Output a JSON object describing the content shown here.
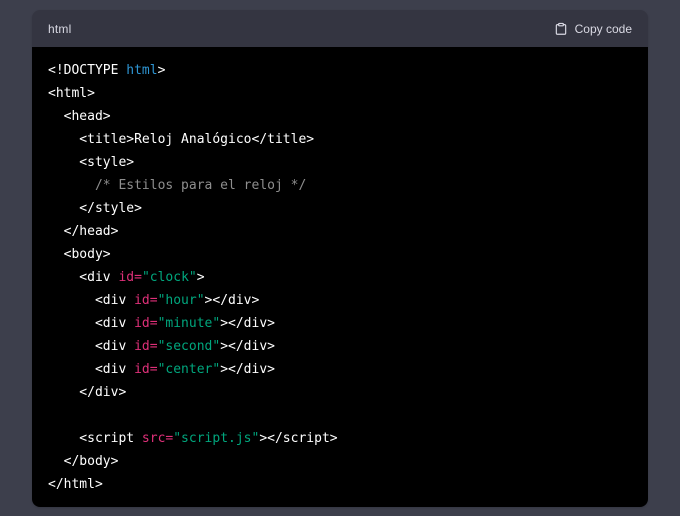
{
  "code_block": {
    "language_label": "html",
    "copy_button": {
      "label": "Copy code",
      "icon": "clipboard-icon"
    },
    "colors": {
      "page_bg": "#3d3f4c",
      "header_bg": "#343541",
      "code_bg": "#000000",
      "header_text": "#d9d9e3",
      "tag": "#ffffff",
      "keyword": "#2e95d3",
      "attribute": "#df3079",
      "string": "#00a67d",
      "comment": "#8e8e8e"
    },
    "lines": [
      [
        {
          "t": "tag",
          "s": "<!DOCTYPE "
        },
        {
          "t": "kw",
          "s": "html"
        },
        {
          "t": "tag",
          "s": ">"
        }
      ],
      [
        {
          "t": "tag",
          "s": "<html>"
        }
      ],
      [
        {
          "t": "tag",
          "s": "  <head>"
        }
      ],
      [
        {
          "t": "tag",
          "s": "    <title>"
        },
        {
          "t": "txt",
          "s": "Reloj Analógico"
        },
        {
          "t": "tag",
          "s": "</title>"
        }
      ],
      [
        {
          "t": "tag",
          "s": "    <style>"
        }
      ],
      [
        {
          "t": "cmt",
          "s": "      /* Estilos para el reloj */"
        }
      ],
      [
        {
          "t": "tag",
          "s": "    </style>"
        }
      ],
      [
        {
          "t": "tag",
          "s": "  </head>"
        }
      ],
      [
        {
          "t": "tag",
          "s": "  <body>"
        }
      ],
      [
        {
          "t": "tag",
          "s": "    <div "
        },
        {
          "t": "attr",
          "s": "id="
        },
        {
          "t": "str",
          "s": "\"clock\""
        },
        {
          "t": "tag",
          "s": ">"
        }
      ],
      [
        {
          "t": "tag",
          "s": "      <div "
        },
        {
          "t": "attr",
          "s": "id="
        },
        {
          "t": "str",
          "s": "\"hour\""
        },
        {
          "t": "tag",
          "s": "></div>"
        }
      ],
      [
        {
          "t": "tag",
          "s": "      <div "
        },
        {
          "t": "attr",
          "s": "id="
        },
        {
          "t": "str",
          "s": "\"minute\""
        },
        {
          "t": "tag",
          "s": "></div>"
        }
      ],
      [
        {
          "t": "tag",
          "s": "      <div "
        },
        {
          "t": "attr",
          "s": "id="
        },
        {
          "t": "str",
          "s": "\"second\""
        },
        {
          "t": "tag",
          "s": "></div>"
        }
      ],
      [
        {
          "t": "tag",
          "s": "      <div "
        },
        {
          "t": "attr",
          "s": "id="
        },
        {
          "t": "str",
          "s": "\"center\""
        },
        {
          "t": "tag",
          "s": "></div>"
        }
      ],
      [
        {
          "t": "tag",
          "s": "    </div>"
        }
      ],
      [],
      [
        {
          "t": "tag",
          "s": "    <script "
        },
        {
          "t": "attr",
          "s": "src="
        },
        {
          "t": "str",
          "s": "\"script.js\""
        },
        {
          "t": "tag",
          "s": "></script>"
        }
      ],
      [
        {
          "t": "tag",
          "s": "  </body>"
        }
      ],
      [
        {
          "t": "tag",
          "s": "</html>"
        }
      ]
    ]
  }
}
